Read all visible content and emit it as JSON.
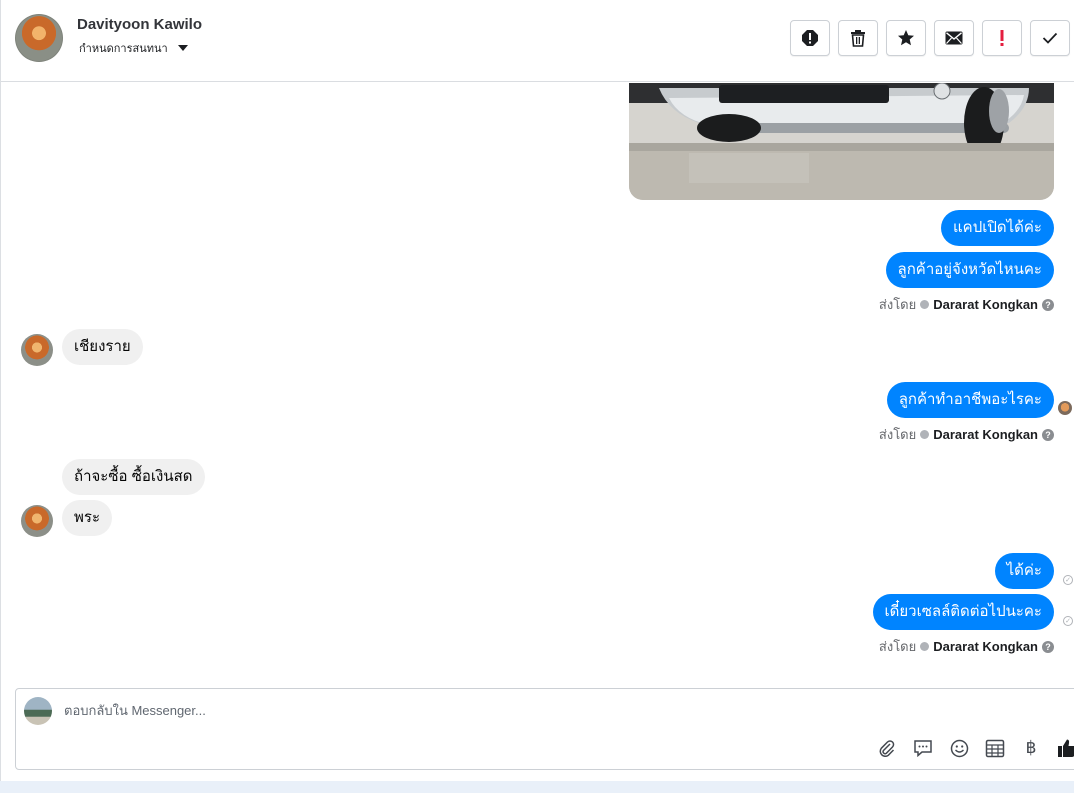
{
  "header": {
    "name": "Davityoon Kawilo",
    "subtitle": "กำหนดการสนทนา",
    "actions": [
      {
        "name": "report-icon"
      },
      {
        "name": "trash-icon"
      },
      {
        "name": "star-icon"
      },
      {
        "name": "envelope-icon"
      },
      {
        "name": "exclamation-icon",
        "color": "#e41e3f"
      },
      {
        "name": "check-icon"
      }
    ]
  },
  "messages": {
    "m1": "แคปเปิดได้ค่ะ",
    "m2": "ลูกค้าอยู่จังหวัดไหนคะ",
    "m3": "เชียงราย",
    "m4": "ลูกค้าทำอาชีพอะไรคะ",
    "m5": "ถ้าจะซื้อ ซื้อเงินสด",
    "m6": "พระ",
    "m7": "ได้ค่ะ",
    "m8": "เดี๋ยวเซลล์ติดต่อไปนะคะ"
  },
  "sent_by": {
    "label": "ส่งโดย",
    "agent": "Dararat Kongkan",
    "help": "?"
  },
  "composer": {
    "placeholder": "ตอบกลับใน Messenger...",
    "tools": [
      "paperclip-icon",
      "comment-icon",
      "emoji-icon",
      "table-icon",
      "baht-icon",
      "thumbs-up-icon"
    ],
    "baht": "฿"
  },
  "colors": {
    "outgoing": "#0084ff",
    "incoming": "#f0f0f0"
  }
}
